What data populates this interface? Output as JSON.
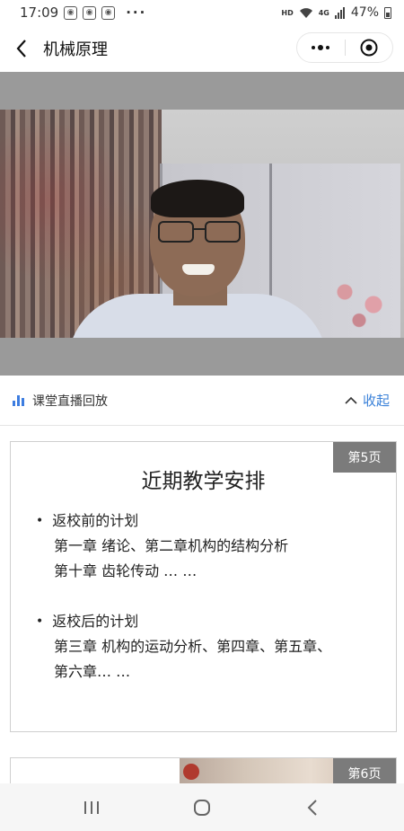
{
  "status_bar": {
    "time": "17:09",
    "notification_icons": [
      "app-notification-icon",
      "app-notification-icon",
      "app-notification-icon"
    ],
    "more_indicator": "···",
    "hd": "HD",
    "network": "4G",
    "battery": "47%"
  },
  "nav": {
    "title": "机械原理"
  },
  "replay": {
    "label": "课堂直播回放",
    "collapse_label": "收起"
  },
  "slides": [
    {
      "page": "第5页",
      "title": "近期教学安排",
      "sections": [
        {
          "heading": "返校前的计划",
          "lines": [
            "第一章 绪论、第二章机构的结构分析",
            "第十章 齿轮传动 … …"
          ]
        },
        {
          "heading": "返校后的计划",
          "lines": [
            "第三章 机构的运动分析、第四章、第五章、",
            "第六章… …"
          ]
        }
      ]
    },
    {
      "page": "第6页"
    }
  ],
  "colors": {
    "accent": "#3b82d9",
    "badge": "#7b7b7b"
  }
}
